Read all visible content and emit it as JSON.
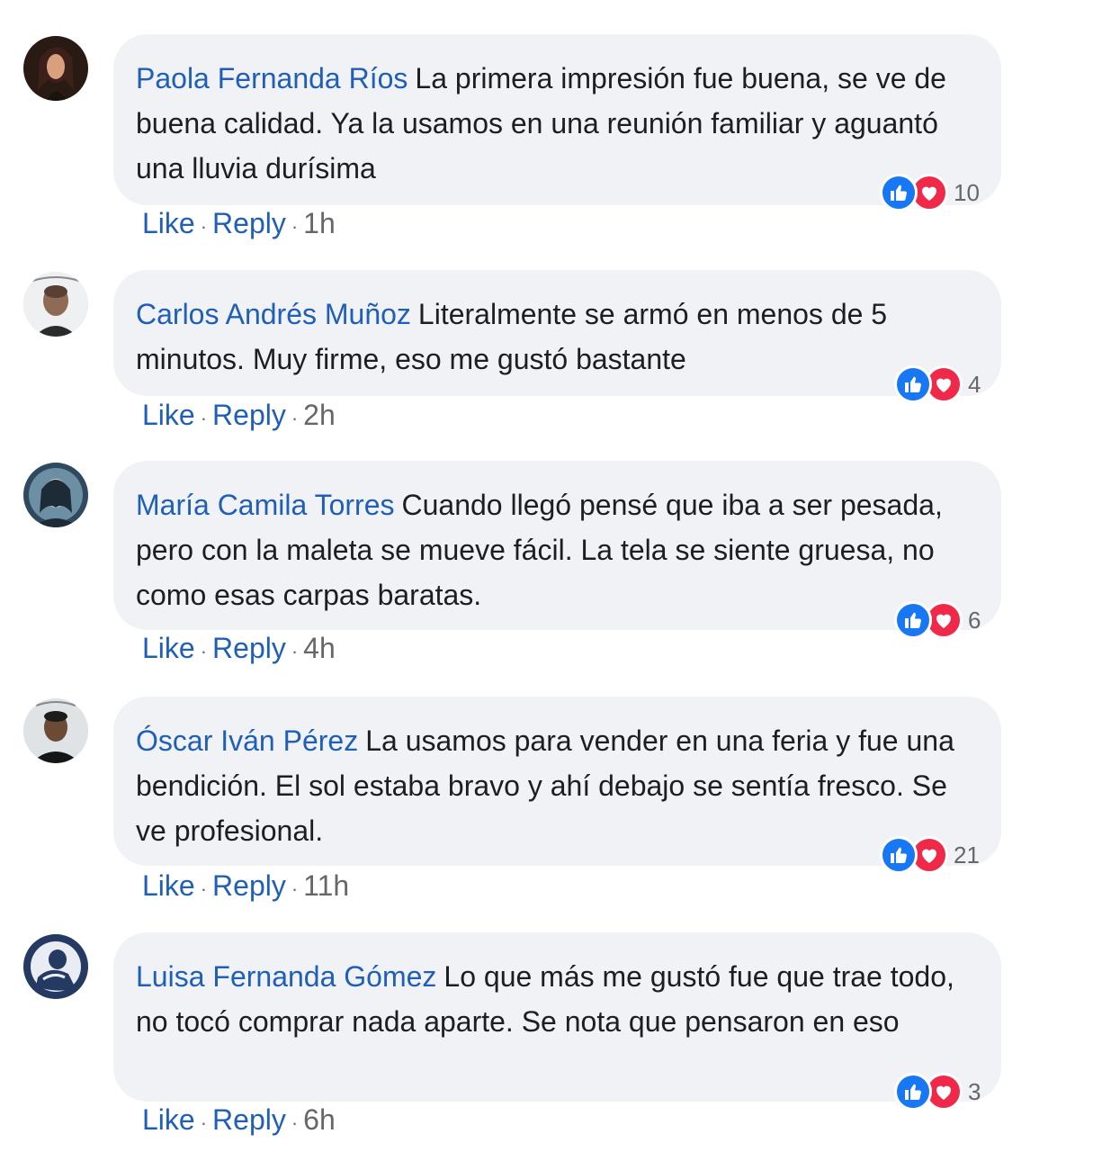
{
  "action_labels": {
    "like": "Like",
    "reply": "Reply",
    "separator": "·"
  },
  "reaction_colors": {
    "like": "#1877f2",
    "love": "#f02849"
  },
  "comments": [
    {
      "author": "Paola Fernanda Ríos",
      "text": "La primera impresión fue buena, se ve de buena calidad. Ya la usamos en una reunión familiar y aguantó una lluvia durísima",
      "reactions": "10",
      "time": "1h"
    },
    {
      "author": "Carlos Andrés Muñoz",
      "text": "Literalmente se armó en menos de 5 minutos. Muy firme, eso me gustó bastante",
      "reactions": "4",
      "time": "2h"
    },
    {
      "author": "María Camila Torres",
      "text": "Cuando llegó pensé que iba a ser pesada, pero con la maleta se mueve fácil. La tela se siente gruesa, no como esas carpas baratas.",
      "reactions": "6",
      "time": "4h"
    },
    {
      "author": "Óscar Iván Pérez",
      "text": "La usamos para vender en una feria y fue una bendición. El sol estaba bravo y ahí debajo se sentía fresco. Se ve profesional.",
      "reactions": "21",
      "time": "11h"
    },
    {
      "author": "Luisa Fernanda Gómez",
      "text": "Lo que más me gustó fue que trae todo, no tocó comprar nada aparte. Se nota que pensaron en eso",
      "reactions": "3",
      "time": "6h"
    }
  ]
}
